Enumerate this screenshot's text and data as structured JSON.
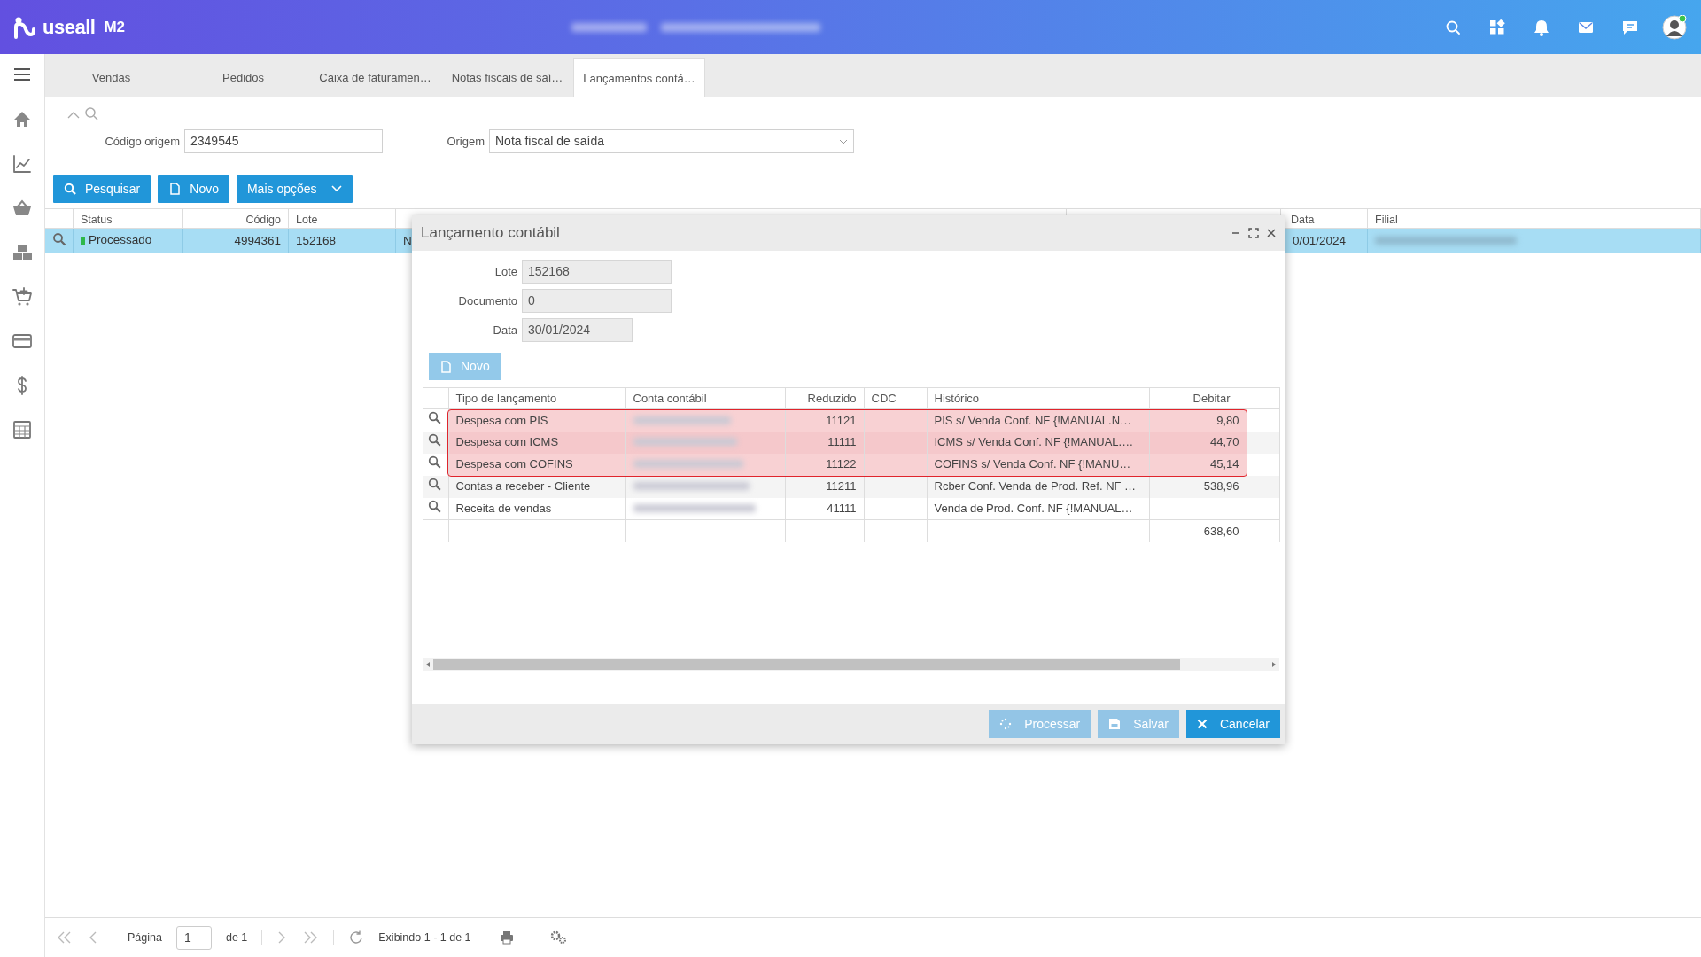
{
  "header": {
    "logo": "useall",
    "logo_suffix": "M2"
  },
  "tabs": [
    {
      "label": "Vendas",
      "selected": false
    },
    {
      "label": "Pedidos",
      "selected": false
    },
    {
      "label": "Caixa de faturamen…",
      "selected": false
    },
    {
      "label": "Notas fiscais de saí…",
      "selected": false
    },
    {
      "label": "Lançamentos contá…",
      "selected": true
    }
  ],
  "filters": [
    {
      "label": "Código origem",
      "value": "2349545",
      "kind": "text"
    },
    {
      "label": "Origem",
      "value": "Nota fiscal de saída",
      "kind": "select"
    }
  ],
  "actions": [
    {
      "label": "Pesquisar",
      "kind": "search"
    },
    {
      "label": "Novo",
      "kind": "new"
    },
    {
      "label": "Mais opções",
      "kind": "menu"
    }
  ],
  "table": {
    "columns": [
      "Status",
      "Código",
      "Lote",
      "",
      "",
      "Data",
      "Filial"
    ],
    "rows": [
      {
        "status": "Processado",
        "color": "#2eb84a",
        "codigo": "4994361",
        "lote": "152168",
        "origem": "N",
        "data": "0/01/2024",
        "selected": true
      }
    ]
  },
  "dialog": {
    "title": "Lançamento contábil",
    "fields": [
      {
        "label": "Lote",
        "value": "152168"
      },
      {
        "label": "Documento",
        "value": "0"
      },
      {
        "label": "Data",
        "value": "30/01/2024"
      }
    ],
    "new_button": "Novo",
    "grid": {
      "columns": [
        "Tipo de lançamento",
        "Conta contábil",
        "Reduzido",
        "CDC",
        "Histórico",
        "Debitar"
      ],
      "rows": [
        {
          "tipo": "Despesa com PIS",
          "reduzido": "11121",
          "historico": "PIS s/ Venda Conf. NF {!MANUAL.N…",
          "debitar": "9,80",
          "highlighted": true
        },
        {
          "tipo": "Despesa com ICMS",
          "reduzido": "11111",
          "historico": "ICMS s/ Venda Conf. NF {!MANUAL.…",
          "debitar": "44,70",
          "highlighted": true
        },
        {
          "tipo": "Despesa com COFINS",
          "reduzido": "11122",
          "historico": "COFINS s/ Venda Conf. NF {!MANU…",
          "debitar": "45,14",
          "highlighted": true
        },
        {
          "tipo": "Contas a receber - Cliente",
          "reduzido": "11211",
          "historico": "Rcber Conf. Venda de Prod. Ref. NF …",
          "debitar": "538,96",
          "highlighted": false
        },
        {
          "tipo": "Receita de vendas",
          "reduzido": "41111",
          "historico": "Venda de Prod. Conf. NF {!MANUAL…",
          "debitar": "",
          "highlighted": false
        }
      ],
      "total": "638,60"
    },
    "buttons": [
      {
        "label": "Processar",
        "kind": "process",
        "disabled": true
      },
      {
        "label": "Salvar",
        "kind": "save",
        "disabled": true
      },
      {
        "label": "Cancelar",
        "kind": "cancel",
        "disabled": false
      }
    ]
  },
  "pagination": {
    "page_label": "Página",
    "page": "1",
    "of": "de 1",
    "info": "Exibindo 1 - 1 de 1"
  }
}
